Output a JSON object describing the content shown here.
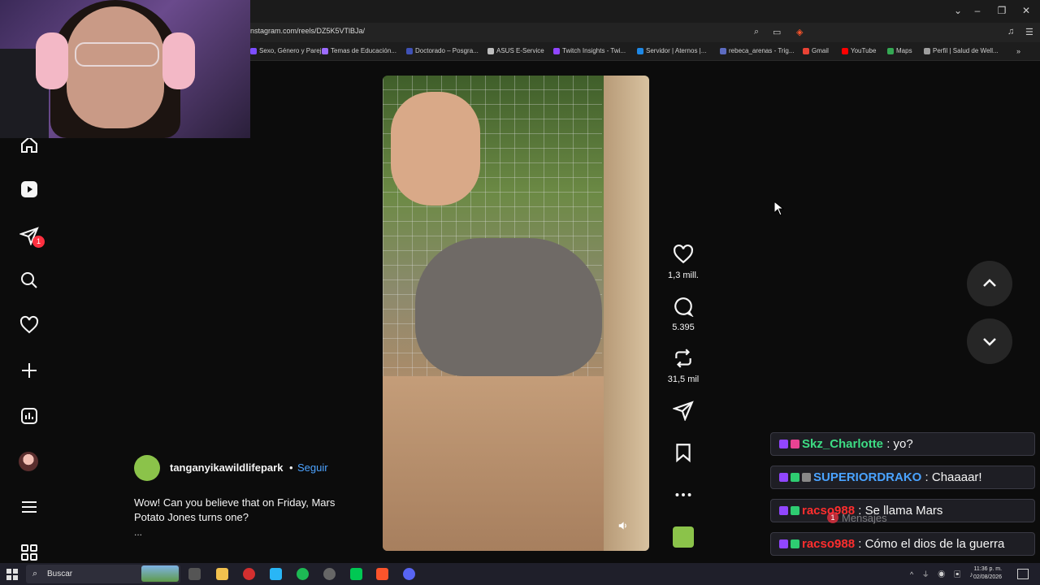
{
  "browser": {
    "url": "nstagram.com/reels/DZ5K5VTlBJa/",
    "bookmarks": [
      {
        "label": "Sexo, Género y Parej...",
        "color": "#7c4dff"
      },
      {
        "label": "Temas de Educación...",
        "color": "#9c6bff"
      },
      {
        "label": "Doctorado – Posgra...",
        "color": "#3f51b5"
      },
      {
        "label": "ASUS E-Service",
        "color": "#bdbdbd"
      },
      {
        "label": "Twitch Insights - Twi...",
        "color": "#9146ff"
      },
      {
        "label": "Servidor | Aternos |...",
        "color": "#1e88e5"
      },
      {
        "label": "rebeca_arenas - Trig...",
        "color": "#5c6bc0"
      },
      {
        "label": "Gmail",
        "color": "#ea4335"
      },
      {
        "label": "YouTube",
        "color": "#ff0000"
      },
      {
        "label": "Maps",
        "color": "#34a853"
      },
      {
        "label": "Perfil | Salud de Well...",
        "color": "#9e9e9e"
      }
    ]
  },
  "nav": {
    "notification_count": "1"
  },
  "post": {
    "username": "tanganyikawildlifepark",
    "separator": "•",
    "follow_label": "Seguir",
    "caption": "Wow! Can you believe that on Friday, Mars Potato Jones turns one?",
    "more": "..."
  },
  "actions": {
    "likes": "1,3 mill.",
    "comments": "5.395",
    "reposts": "31,5 mil"
  },
  "chat": [
    {
      "user": "Skz_Charlotte",
      "color": "#3ddc84",
      "badges": [
        "#9146ff",
        "#e84393"
      ],
      "message": " : yo?"
    },
    {
      "user": "SUPERIORDRAKO",
      "color": "#4aa3ff",
      "badges": [
        "#9146ff",
        "#2ecc71",
        "#888888"
      ],
      "message": " : Chaaaar!"
    },
    {
      "user": "racso988",
      "color": "#ff2e2e",
      "badges": [
        "#9146ff",
        "#2ecc71"
      ],
      "message": " : Se llama Mars"
    },
    {
      "user": "racso988",
      "color": "#ff2e2e",
      "badges": [
        "#9146ff",
        "#2ecc71"
      ],
      "message": " : Cómo el dios de la guerra"
    }
  ],
  "overlay": {
    "messages_label": "Mensajes",
    "messages_count": "1"
  },
  "taskbar": {
    "search_placeholder": "Buscar",
    "time": "11:36 p. m.",
    "date": "02/08/2026"
  }
}
